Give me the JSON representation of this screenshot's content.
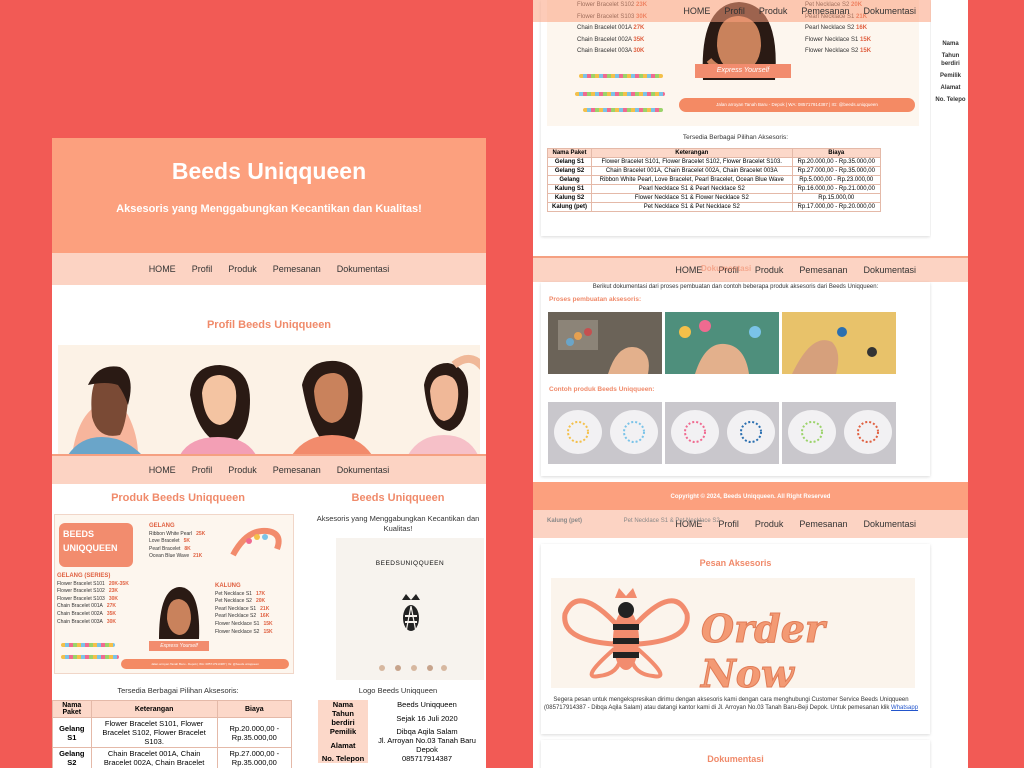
{
  "site": {
    "title": "Beeds Uniqqueen",
    "tagline": "Aksesoris yang Menggabungkan Kecantikan dan Kualitas!"
  },
  "nav": [
    "HOME",
    "Profil",
    "Produk",
    "Pemesanan",
    "Dokumentasi"
  ],
  "profil": {
    "title": "Profil Beeds Uniqqueen"
  },
  "produk": {
    "title": "Produk Beeds Uniqqueen",
    "available_caption": "Tersedia Berbagai Pilihan Aksesoris:",
    "catalog": {
      "brand_line1": "BEEDS",
      "brand_line2": "UNIQQUEEN",
      "gelang_head": "GELANG",
      "gelang": [
        {
          "name": "Ribbon White Pearl",
          "price": "25K"
        },
        {
          "name": "Love Bracelet",
          "price": "5K"
        },
        {
          "name": "Pearl Bracelet",
          "price": "8K"
        },
        {
          "name": "Ocean Blue Wave",
          "price": "21K"
        }
      ],
      "gelang_series_head": "GELANG (SERIES)",
      "gelang_series": [
        {
          "name": "Flower Bracelet S101",
          "price": "20K-35K"
        },
        {
          "name": "Flower Bracelet S102",
          "price": "23K"
        },
        {
          "name": "Flower Bracelet S103",
          "price": "30K"
        },
        {
          "name": "Chain Bracelet 001A",
          "price": "27K"
        },
        {
          "name": "Chain Bracelet 002A",
          "price": "35K"
        },
        {
          "name": "Chain Bracelet 003A",
          "price": "30K"
        }
      ],
      "kalung_head": "KALUNG",
      "kalung": [
        {
          "name": "Pet Necklace S1",
          "price": "17K"
        },
        {
          "name": "Pet Necklace S2",
          "price": "20K"
        },
        {
          "name": "Pearl Necklace S1",
          "price": "21K"
        },
        {
          "name": "Pearl Necklace S2",
          "price": "16K"
        },
        {
          "name": "Flower Necklace S1",
          "price": "15K"
        },
        {
          "name": "Flower Necklace S2",
          "price": "15K"
        }
      ],
      "ribbon_text": "Express Yourself",
      "footer_text": "Jalan arroyan Tanah Baru - Depok | WA: 085717914387 | IG: @beeds.uniqqueen"
    },
    "table_headers": [
      "Nama Paket",
      "Keterangan",
      "Biaya"
    ],
    "table_left": [
      [
        "Gelang S1",
        "Flower Bracelet S101, Flower Bracelet S102, Flower Bracelet S103.",
        "Rp.20.000,00 - Rp.35.000,00"
      ],
      [
        "Gelang S2",
        "Chain Bracelet 001A, Chain Bracelet 002A, Chain Bracelet",
        "Rp.27.000,00 - Rp.35.000,00"
      ]
    ],
    "table_full": [
      [
        "Gelang S1",
        "Flower Bracelet S101, Flower Bracelet S102, Flower Bracelet S103.",
        "Rp.20.000,00 - Rp.35.000,00"
      ],
      [
        "Gelang S2",
        "Chain Bracelet 001A, Chain Bracelet 002A, Chain Bracelet 003A",
        "Rp.27.000,00 - Rp.35.000,00"
      ],
      [
        "Gelang",
        "Ribbon White Pearl, Love Bracelet, Pearl Bracelet, Ocean Blue Wave",
        "Rp.5.000,00 - Rp.23.000,00"
      ],
      [
        "Kalung S1",
        "Pearl Necklace S1 & Pearl Necklace S2",
        "Rp.16.000,00 - Rp.21.000,00"
      ],
      [
        "Kalung S2",
        "Flower Necklace S1 & Flower Necklace S2",
        "Rp.15.000,00"
      ],
      [
        "Kalung (pet)",
        "Pet Necklace S1 & Pet Necklace S2",
        "Rp.17.000,00 - Rp.20.000,00"
      ]
    ]
  },
  "beeds": {
    "title": "Beeds Uniqqueen",
    "desc": "Aksesoris yang Menggabungkan Kecantikan dan Kualitas!",
    "logo_text": "BEEDSUNIQQUEEN",
    "logo_caption": "Logo Beeds Uniqqueen",
    "info": [
      {
        "k": "Nama",
        "v": "Beeds Uniqqueen"
      },
      {
        "k": "Tahun berdiri",
        "v": "Sejak 16 Juli 2020"
      },
      {
        "k": "Pemilik",
        "v": "Dibqa Aqila Salam"
      },
      {
        "k": "Alamat",
        "v": "Jl. Arroyan No.03 Tanah Baru Depok"
      },
      {
        "k": "No. Telepon",
        "v": "085717914387"
      }
    ],
    "side_labels": [
      "Nama",
      "Tahun berdiri",
      "Pemilik",
      "Alamat",
      "No. Telepo"
    ]
  },
  "dokumentasi": {
    "title": "Dokumentasi",
    "intro": "Berikut dokumentasi dari proses pembuatan dan contoh beberapa produk aksesoris dari Beeds Uniqqueen:",
    "proses_title": "Proses pembuatan aksesoris:",
    "contoh_title": "Contoh produk Beeds Uniqqueen:"
  },
  "footer": {
    "copyright": "Copyright © 2024, Beeds Uniqqueen. All Right Reserved"
  },
  "pesan": {
    "title": "Pesan Aksesoris",
    "order_text": "Order Now",
    "body": "Segera pesan untuk mengekspresikan dirimu dengan aksesoris kami dengan cara menghubungi Customer Service Beeds Uniqqueen (085717914387 - Dibqa Aqila Salam) atau datangi kantor kami di Jl. Arroyan No.03 Tanah Baru-Beji Depok. Untuk pemesanan klik",
    "link": "Whatsapp"
  },
  "colors": {
    "background": "#f25a55",
    "accent": "#fca07e",
    "nav": "#fcd3c3",
    "title": "#f08a6a"
  }
}
